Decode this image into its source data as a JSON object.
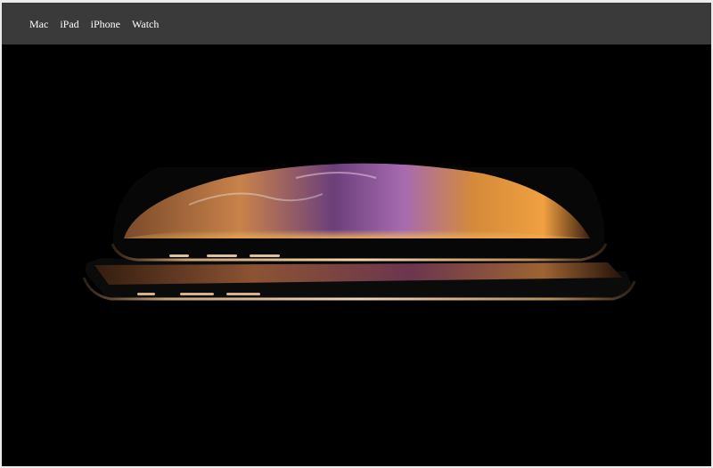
{
  "nav": {
    "items": [
      {
        "label": "Mac"
      },
      {
        "label": "iPad"
      },
      {
        "label": "iPhone"
      },
      {
        "label": "Watch"
      }
    ]
  },
  "hero": {
    "image": "hero-iphone-image",
    "colors": {
      "background": "#000000",
      "navbar": "#3a3a3a",
      "gold": "#c9a57a",
      "purple": "#6b3f7a"
    }
  }
}
